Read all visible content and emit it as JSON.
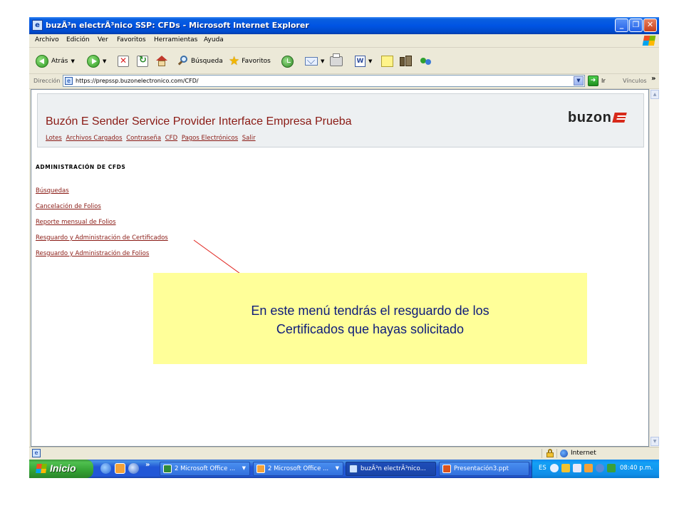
{
  "window": {
    "title": "buzÃ³n electrÃ³nico SSP: CFDs - Microsoft Internet Explorer"
  },
  "menubar": {
    "items": [
      "Archivo",
      "Edición",
      "Ver",
      "Favoritos",
      "Herramientas",
      "Ayuda"
    ]
  },
  "toolbar": {
    "back_label": "Atrás",
    "search_label": "Búsqueda",
    "favorites_label": "Favoritos"
  },
  "addressbar": {
    "label": "Dirección",
    "url": "https://prepssp.buzonelectronico.com/CFD/",
    "go_label": "Ir",
    "links_label": "Vínculos"
  },
  "page": {
    "title": "Buzón E Sender Service Provider Interface Empresa Prueba",
    "logo_text": "buzon",
    "nav": [
      "Lotes",
      "Archivos Cargados",
      "Contraseña",
      "CFD",
      "Pagos Electrónicos",
      "Salir"
    ],
    "section_title": "ADMINISTRACIÓN DE CFDS",
    "menu": [
      "Búsquedas",
      "Cancelación de Folios",
      "Reporte mensual de Folios",
      "Resguardo y Administración de Certificados",
      "Resguardo y Administración de Folios"
    ]
  },
  "callout": {
    "line1": "En este menú tendrás el resguardo de los",
    "line2": "Certificados que hayas solicitado"
  },
  "statusbar": {
    "zone": "Internet"
  },
  "taskbar": {
    "start_label": "Inicio",
    "tasks": [
      "2 Microsoft Office ...",
      "2 Microsoft Office ...",
      "buzÃ³n electrÃ³nico...",
      "Presentación3.ppt"
    ],
    "language": "ES",
    "clock": "08:40 p.m."
  },
  "colors": {
    "link": "#8a1a14",
    "callout_bg": "#ffff99",
    "callout_text": "#0d1b7a",
    "titlebar": "#0054e3",
    "arrow": "#e0201a"
  },
  "icons": [
    "ie-icon",
    "back-icon",
    "forward-icon",
    "stop-icon",
    "refresh-icon",
    "home-icon",
    "search-icon",
    "star-icon",
    "history-icon",
    "mail-icon",
    "print-icon",
    "edit-icon",
    "discuss-icon",
    "research-icon",
    "messenger-icon",
    "lock-icon",
    "globe-icon"
  ]
}
